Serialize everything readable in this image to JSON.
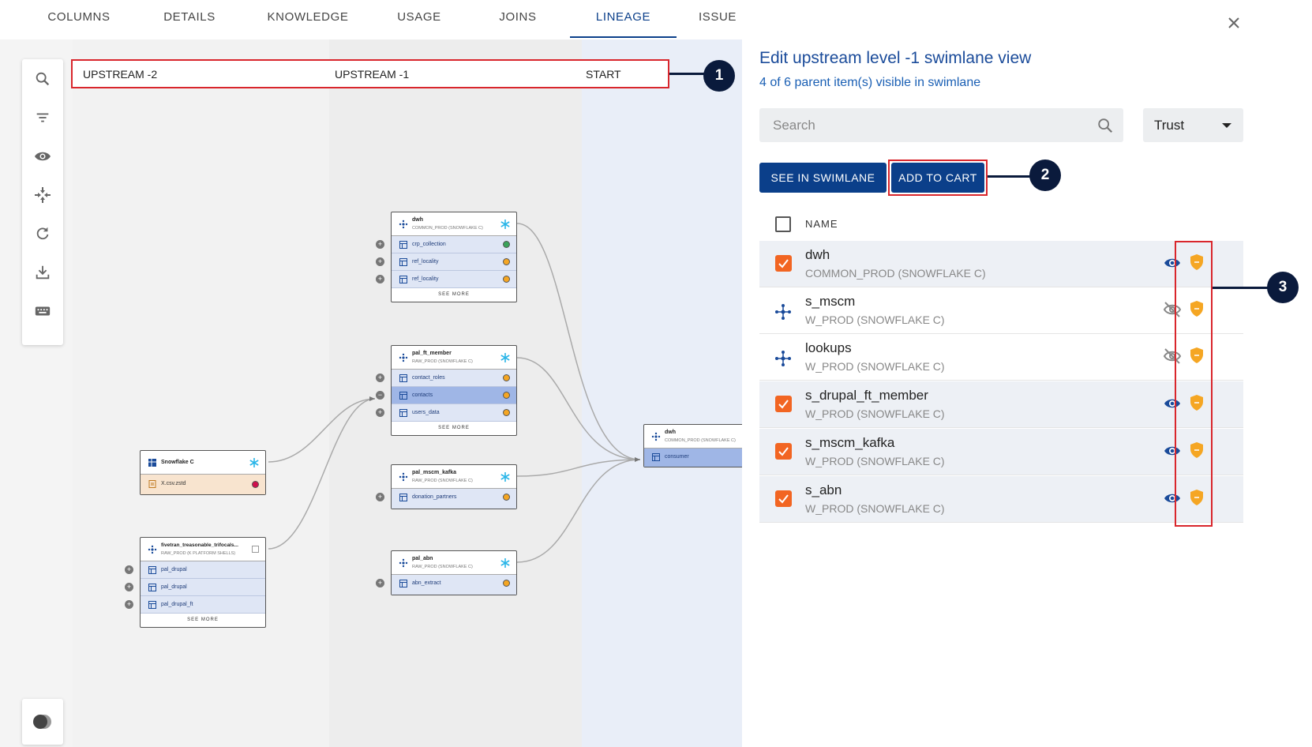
{
  "tabs": [
    "COLUMNS",
    "DETAILS",
    "KNOWLEDGE",
    "USAGE",
    "JOINS",
    "LINEAGE",
    "ISSUE"
  ],
  "active_tab": "LINEAGE",
  "swimlane_headers": [
    "UPSTREAM -2",
    "UPSTREAM -1",
    "START"
  ],
  "callouts": [
    "1",
    "2",
    "3"
  ],
  "nodes": {
    "snowflake": {
      "title": "Snowflake C",
      "rows": [
        "X.csv.zstd"
      ]
    },
    "fivetran": {
      "title": "fivetran_treasonable_trifocals...",
      "subtitle": "RAW_PROD (K PLATFORM SHELLS)",
      "rows": [
        "pal_drupal",
        "pal_drupal",
        "pal_drupal_ft"
      ],
      "see_more": "SEE MORE"
    },
    "dwh": {
      "title": "dwh",
      "subtitle": "COMMON_PROD (SNOWFLAKE C)",
      "rows": [
        "crp_collection",
        "ref_locality",
        "ref_locality"
      ],
      "see_more": "SEE MORE"
    },
    "pal_ft_member": {
      "title": "pal_ft_member",
      "subtitle": "RAW_PROD (SNOWFLAKE C)",
      "rows": [
        "contact_roles",
        "contacts",
        "users_data"
      ],
      "see_more": "SEE MORE"
    },
    "pal_mscm_kafka": {
      "title": "pal_mscm_kafka",
      "subtitle": "RAW_PROD (SNOWFLAKE C)",
      "rows": [
        "donation_partners"
      ]
    },
    "pal_abn": {
      "title": "pal_abn",
      "subtitle": "RAW_PROD (SNOWFLAKE C)",
      "rows": [
        "abn_extract"
      ]
    },
    "start_dwh": {
      "title": "dwh",
      "subtitle": "COMMON_PROD (SNOWFLAKE C)",
      "rows": [
        "consumer"
      ]
    }
  },
  "panel": {
    "title": "Edit upstream level -1 swimlane view",
    "subtitle": "4 of 6 parent item(s) visible in swimlane",
    "search_placeholder": "Search",
    "filter_value": "Trust",
    "see_in_swimlane": "SEE IN SWIMLANE",
    "add_to_cart": "ADD TO CART",
    "name_header": "NAME",
    "items": [
      {
        "name": "dwh",
        "sub": "COMMON_PROD (SNOWFLAKE C)",
        "checked": true,
        "visible": true
      },
      {
        "name": "s_mscm",
        "sub": "W_PROD (SNOWFLAKE C)",
        "checked": false,
        "visible": false
      },
      {
        "name": "lookups",
        "sub": "W_PROD (SNOWFLAKE C)",
        "checked": false,
        "visible": false
      },
      {
        "name": "s_drupal_ft_member",
        "sub": "W_PROD (SNOWFLAKE C)",
        "checked": true,
        "visible": true
      },
      {
        "name": "s_mscm_kafka",
        "sub": "W_PROD (SNOWFLAKE C)",
        "checked": true,
        "visible": true
      },
      {
        "name": "s_abn",
        "sub": "W_PROD (SNOWFLAKE C)",
        "checked": true,
        "visible": true
      }
    ]
  },
  "colors": {
    "accent": "#0b3f8a",
    "highlight": "#d9262c",
    "checkbox": "#f26522",
    "trust_shield": "#f5a623",
    "callout": "#0a1a3c"
  }
}
